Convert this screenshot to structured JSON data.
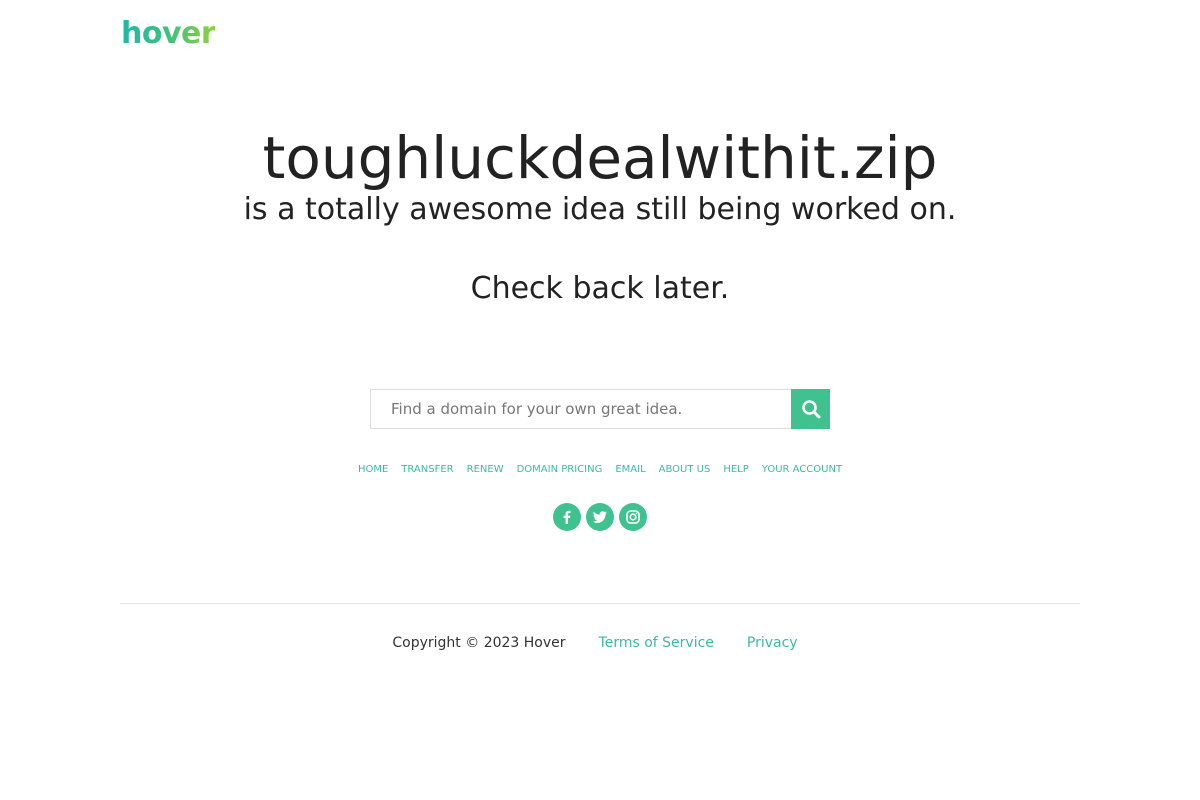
{
  "header": {
    "logo_text": "hover",
    "logo_colors": [
      "#1fb8a6",
      "#3fc07f",
      "#8fd13c"
    ]
  },
  "main": {
    "domain": "toughluckdealwithit.zip",
    "subtitle": "is a totally awesome idea still being worked on.",
    "check_back": "Check back later."
  },
  "search": {
    "placeholder": "Find a domain for your own great idea.",
    "value": "",
    "button_icon": "search-icon",
    "accent": "#3fc190"
  },
  "nav": {
    "items": [
      {
        "label": "Home"
      },
      {
        "label": "Transfer"
      },
      {
        "label": "Renew"
      },
      {
        "label": "Domain Pricing"
      },
      {
        "label": "Email"
      },
      {
        "label": "About Us"
      },
      {
        "label": "Help"
      },
      {
        "label": "Your Account"
      }
    ],
    "link_color": "#3fb7a6"
  },
  "social": {
    "icons": [
      "facebook-icon",
      "twitter-icon",
      "instagram-icon"
    ]
  },
  "footer": {
    "copyright": "Copyright © 2023 Hover",
    "terms_label": "Terms of Service",
    "privacy_label": "Privacy"
  }
}
